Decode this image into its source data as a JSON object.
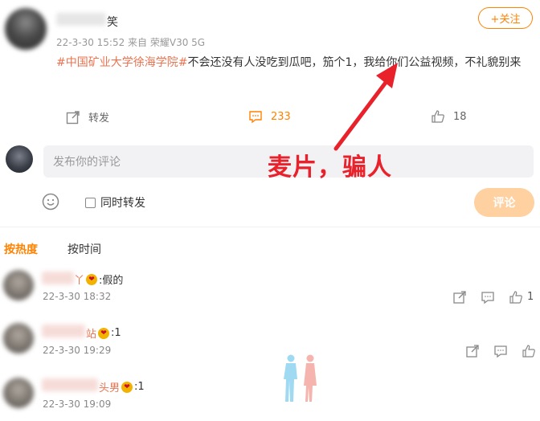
{
  "post": {
    "author_suffix": "笑",
    "meta": "22-3-30 15:52 来自 荣耀V30 5G",
    "follow_label": "+关注",
    "topic": "#中国矿业大学徐海学院#",
    "text": "不会还没有人没吃到瓜吧，笳个1，我给你们公益视频，不礼貌别来"
  },
  "actions": {
    "repost_label": "转发",
    "comment_count": "233",
    "like_count": "18"
  },
  "composer": {
    "placeholder": "发布你的评论",
    "repost_label": "同时转发",
    "submit_label": "评论"
  },
  "annotation": {
    "text": "麦片，骗人",
    "color": "#e8212b"
  },
  "sort": {
    "hot": "按热度",
    "time": "按时间"
  },
  "comments": [
    {
      "name_suffix": "丫",
      "text": ":假的",
      "time": "22-3-30 18:32",
      "likes": "1"
    },
    {
      "name_suffix": "站",
      "text": ":1",
      "time": "22-3-30 19:29"
    },
    {
      "name_suffix": "头男",
      "text": ":1",
      "time": "22-3-30 19:09"
    }
  ],
  "colors": {
    "accent": "#ff8200",
    "topic": "#eb7350"
  }
}
